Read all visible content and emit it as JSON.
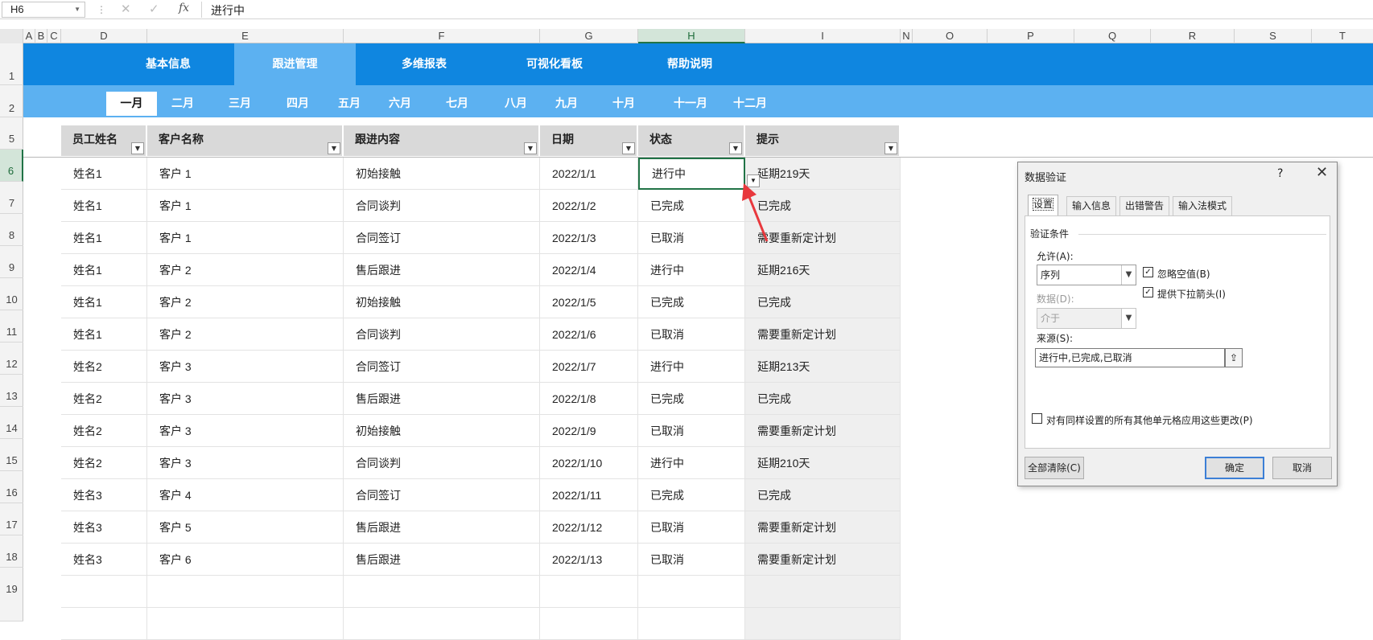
{
  "formula_bar": {
    "name_box": "H6",
    "fx": "fx",
    "value": "进行中"
  },
  "columns": [
    "A",
    "B",
    "C",
    "D",
    "E",
    "F",
    "G",
    "H",
    "I",
    "N",
    "O",
    "P",
    "Q",
    "R",
    "S",
    "T"
  ],
  "rows": [
    "1",
    "2",
    "5",
    "6",
    "7",
    "8",
    "9",
    "10",
    "11",
    "12",
    "13",
    "14",
    "15",
    "16",
    "17",
    "18",
    "19"
  ],
  "nav_main": [
    "基本信息",
    "跟进管理",
    "多维报表",
    "可视化看板",
    "帮助说明"
  ],
  "nav_months": [
    "一月",
    "二月",
    "三月",
    "四月",
    "五月",
    "六月",
    "七月",
    "八月",
    "九月",
    "十月",
    "十一月",
    "十二月"
  ],
  "table": {
    "headers": [
      "员工姓名",
      "客户名称",
      "跟进内容",
      "日期",
      "状态",
      "提示"
    ],
    "rows": [
      [
        "姓名1",
        "客户 1",
        "初始接触",
        "2022/1/1",
        "进行中",
        "延期219天"
      ],
      [
        "姓名1",
        "客户 1",
        "合同谈判",
        "2022/1/2",
        "已完成",
        "已完成"
      ],
      [
        "姓名1",
        "客户 1",
        "合同签订",
        "2022/1/3",
        "已取消",
        "需要重新定计划"
      ],
      [
        "姓名1",
        "客户 2",
        "售后跟进",
        "2022/1/4",
        "进行中",
        "延期216天"
      ],
      [
        "姓名1",
        "客户 2",
        "初始接触",
        "2022/1/5",
        "已完成",
        "已完成"
      ],
      [
        "姓名1",
        "客户 2",
        "合同谈判",
        "2022/1/6",
        "已取消",
        "需要重新定计划"
      ],
      [
        "姓名2",
        "客户 3",
        "合同签订",
        "2022/1/7",
        "进行中",
        "延期213天"
      ],
      [
        "姓名2",
        "客户 3",
        "售后跟进",
        "2022/1/8",
        "已完成",
        "已完成"
      ],
      [
        "姓名2",
        "客户 3",
        "初始接触",
        "2022/1/9",
        "已取消",
        "需要重新定计划"
      ],
      [
        "姓名2",
        "客户 3",
        "合同谈判",
        "2022/1/10",
        "进行中",
        "延期210天"
      ],
      [
        "姓名3",
        "客户 4",
        "合同签订",
        "2022/1/11",
        "已完成",
        "已完成"
      ],
      [
        "姓名3",
        "客户 5",
        "售后跟进",
        "2022/1/12",
        "已取消",
        "需要重新定计划"
      ],
      [
        "姓名3",
        "客户 6",
        "售后跟进",
        "2022/1/13",
        "已取消",
        "需要重新定计划"
      ]
    ]
  },
  "dialog": {
    "title": "数据验证",
    "help": "?",
    "close": "✕",
    "tabs": [
      "设置",
      "输入信息",
      "出错警告",
      "输入法模式"
    ],
    "group_label": "验证条件",
    "allow_label": "允许(A):",
    "allow_value": "序列",
    "ignore_blank": "忽略空值(B)",
    "dropdown_arrow": "提供下拉箭头(I)",
    "data_label": "数据(D):",
    "data_value": "介于",
    "source_label": "来源(S):",
    "source_value": "进行中,已完成,已取消",
    "apply_all": "对有同样设置的所有其他单元格应用这些更改(P)",
    "clear_all": "全部清除(C)",
    "ok": "确定",
    "cancel": "取消"
  },
  "colors": {
    "nav_main": "#0f86e0",
    "nav_sub": "#5cb1f1",
    "arrow": "#e8383d",
    "select": "#217346"
  }
}
